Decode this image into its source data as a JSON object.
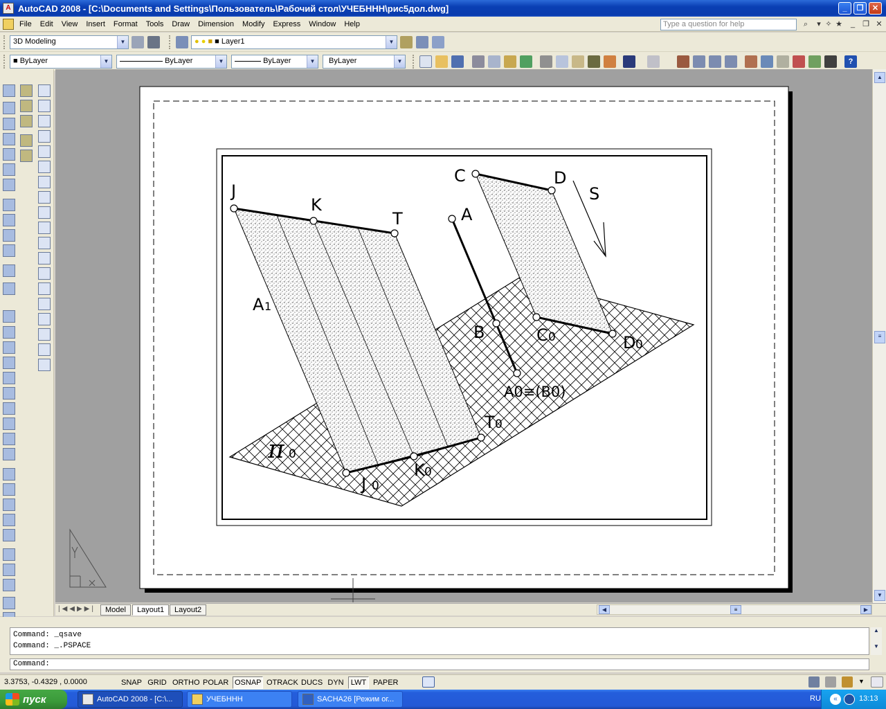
{
  "window": {
    "title": "AutoCAD 2008 - [C:\\Documents and Settings\\Пользователь\\Рабочий стол\\УЧЕБННН\\рис5дол.dwg]"
  },
  "menu": [
    "File",
    "Edit",
    "View",
    "Insert",
    "Format",
    "Tools",
    "Draw",
    "Dimension",
    "Modify",
    "Express",
    "Window",
    "Help"
  ],
  "help_placeholder": "Type a question for help",
  "toolbar": {
    "workspace": "3D Modeling",
    "layer": "Layer1",
    "color": "ByLayer",
    "linetype": "ByLayer",
    "lineweight": "ByLayer",
    "plotstyle": "ByLayer"
  },
  "drawing": {
    "labels": {
      "J": "J",
      "K": "K",
      "T": "T",
      "C": "C",
      "D": "D",
      "A": "A",
      "S": "S",
      "A1": "A",
      "A1_sub": "1",
      "B": "B",
      "C0": "C",
      "C0_sub": "0",
      "D0": "D",
      "D0_sub": "0",
      "A0B0": "A0≡(B0)",
      "T0": "T",
      "T0_sub": "0",
      "K0": "K",
      "K0_sub": "0",
      "J0": "J",
      "J0_sub": "0",
      "pi0": "π",
      "pi0_sub": "0"
    }
  },
  "tabs": [
    "Model",
    "Layout1",
    "Layout2"
  ],
  "active_tab": "Layout1",
  "command_history": [
    "Command: _qsave",
    "Command: _.PSPACE"
  ],
  "command_prompt": "Command:",
  "status": {
    "coords": "3.3753, -0.4329 , 0.0000",
    "buttons": [
      {
        "label": "SNAP",
        "on": false
      },
      {
        "label": "GRID",
        "on": false
      },
      {
        "label": "ORTHO",
        "on": false
      },
      {
        "label": "POLAR",
        "on": false
      },
      {
        "label": "OSNAP",
        "on": true
      },
      {
        "label": "OTRACK",
        "on": false
      },
      {
        "label": "DUCS",
        "on": false
      },
      {
        "label": "DYN",
        "on": false
      },
      {
        "label": "LWT",
        "on": true
      },
      {
        "label": "PAPER",
        "on": false
      }
    ]
  },
  "taskbar": {
    "start": "пуск",
    "tasks": [
      "AutoCAD 2008 - [C:\\...",
      "УЧЕБННН",
      "SACHA26 [Режим ог..."
    ],
    "lang": "RU",
    "time": "13:13"
  }
}
